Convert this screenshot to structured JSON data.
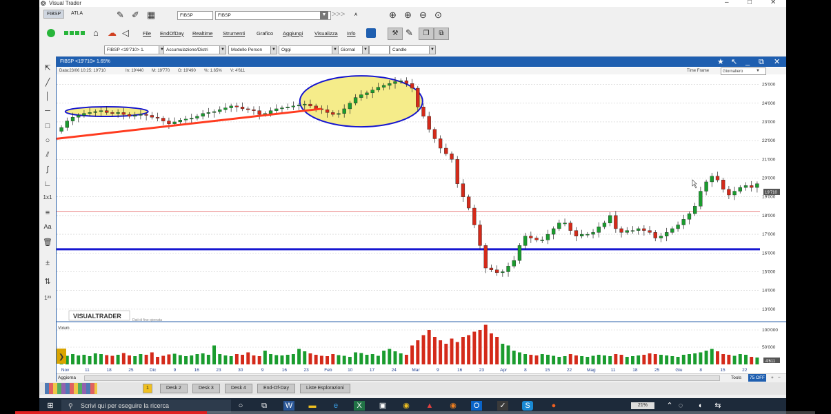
{
  "app": {
    "title": "Visual Trader",
    "tabs": [
      "FIBSP",
      "ATLA"
    ],
    "symbol_fields": [
      "FIBSP",
      "FIBSP"
    ],
    "chevrons": ">>>",
    "menu": [
      "File",
      "EndOfDay",
      "Realtime",
      "Strumenti",
      "Grafico",
      "Aggiungi",
      "Visualizza",
      "Info"
    ],
    "selectors": {
      "instrument": "FIBSP <19'710> 1.",
      "indicator": "Accumulazione/Distri",
      "model": "Modello Person",
      "period": "Oggi",
      "timeframe": "Giornal",
      "blank": "",
      "chart_type": "Candle"
    }
  },
  "chart_window": {
    "title": "FIBSP <19'710> 1.65%",
    "info": {
      "date": "Data:23/06 10:25: 19'710",
      "open": "In: 19'440",
      "high": "M: 19'770",
      "low": "O: 19'490",
      "pct": "%: 1.65%",
      "vol": "V: 4'611"
    },
    "timeframe_label": "Time Frame",
    "timeframe_value": "Giornaliero",
    "watermark": "VISUALTRADER",
    "watermark_sub": "Dati di fine giornata",
    "volume_label": "Volum",
    "price_badge": "19'710",
    "volume_badge": "4'611",
    "bottom_left": "Aggiorna",
    "bottom_right": [
      "Tools",
      "75 OFF"
    ]
  },
  "desks": [
    "1",
    "Desk 2",
    "Desk 3",
    "Desk 4",
    "End-Of-Day",
    "Liste Esplorazioni"
  ],
  "taskbar": {
    "search_placeholder": "Scrivi qui per eseguire la ricerca",
    "battery": "21%"
  },
  "chart_data": {
    "type": "candlestick",
    "price_axis": [
      "25'000",
      "24'000",
      "23'000",
      "22'000",
      "21'000",
      "20'000",
      "19'000",
      "18'000",
      "17'000",
      "16'000",
      "15'000",
      "14'000",
      "13'000"
    ],
    "ylim": [
      12700,
      25500
    ],
    "volume_axis": [
      "100'000",
      "50'000"
    ],
    "x_ticks": [
      "Nov",
      "11",
      "18",
      "25",
      "Dic",
      "9",
      "16",
      "23",
      "30",
      "9",
      "16",
      "23",
      "Feb",
      "10",
      "17",
      "24",
      "Mar",
      "9",
      "16",
      "23",
      "Apr",
      "8",
      "15",
      "22",
      "Mag",
      "11",
      "18",
      "25",
      "Giu",
      "8",
      "15",
      "22"
    ],
    "levels": [
      {
        "value": 16200,
        "color": "#1515d0"
      },
      {
        "value": 18200,
        "color": "#e05050"
      }
    ],
    "trendline": {
      "from": 22100,
      "to": 23700,
      "color": "#ff3b1f"
    },
    "highlight_color": "#f5ec8a",
    "close": [
      22700,
      23050,
      23250,
      23350,
      23450,
      23500,
      23550,
      23600,
      23500,
      23450,
      23500,
      23400,
      23300,
      23350,
      23400,
      23350,
      23250,
      23200,
      23050,
      22900,
      23000,
      23100,
      23150,
      23200,
      23300,
      23450,
      23500,
      23550,
      23650,
      23750,
      23850,
      23800,
      23700,
      23650,
      23600,
      23400,
      23450,
      23600,
      23700,
      23750,
      23800,
      23850,
      23900,
      23950,
      23850,
      23700,
      23650,
      23500,
      23400,
      23450,
      23700,
      24000,
      24300,
      24450,
      24550,
      24700,
      24850,
      24950,
      25050,
      25150,
      25200,
      25050,
      24800,
      23800,
      23300,
      22600,
      22100,
      21600,
      21300,
      21000,
      19700,
      19000,
      18400,
      17500,
      16400,
      15200,
      15100,
      14950,
      15000,
      15300,
      15600,
      16400,
      16900,
      16800,
      16700,
      16700,
      17000,
      17300,
      17600,
      17600,
      17200,
      16900,
      17000,
      17000,
      17100,
      17400,
      17600,
      18000,
      17300,
      17100,
      17200,
      17200,
      17300,
      17200,
      17100,
      16800,
      16900,
      17100,
      17300,
      17500,
      17800,
      18100,
      18500,
      19300,
      19800,
      20100,
      19900,
      19400,
      19100,
      19300,
      19500,
      19600,
      19500,
      19700
    ],
    "volume": [
      22,
      25,
      30,
      26,
      28,
      24,
      32,
      30,
      27,
      25,
      28,
      33,
      26,
      24,
      30,
      28,
      35,
      22,
      25,
      29,
      31,
      27,
      24,
      26,
      30,
      32,
      28,
      55,
      30,
      26,
      24,
      30,
      28,
      35,
      26,
      24,
      40,
      30,
      27,
      26,
      28,
      30,
      45,
      38,
      32,
      28,
      25,
      24,
      30,
      27,
      25,
      22,
      35,
      33,
      28,
      30,
      25,
      40,
      45,
      38,
      32,
      28,
      55,
      70,
      85,
      100,
      80,
      70,
      60,
      75,
      65,
      80,
      85,
      95,
      100,
      115,
      90,
      80,
      60,
      55,
      40,
      35,
      30,
      28,
      26,
      30,
      28,
      25,
      22,
      24,
      30,
      26,
      24,
      22,
      25,
      28,
      26,
      24,
      30,
      28,
      22,
      24,
      26,
      28,
      32,
      30,
      28,
      26,
      24,
      22,
      28,
      30,
      32,
      35,
      40,
      45,
      38,
      30,
      28,
      25,
      30,
      28,
      22,
      20
    ]
  }
}
